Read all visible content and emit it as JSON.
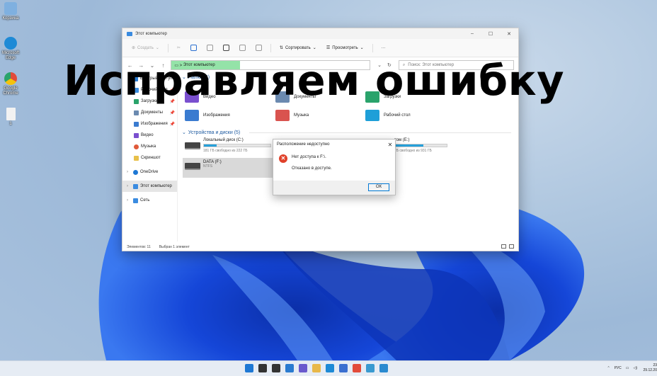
{
  "overlay_heading": "Исправляем ошибку",
  "desktop_icons": [
    {
      "label": "Корзина",
      "icon": "recycle-bin-icon",
      "color": "#7fb0e0"
    },
    {
      "label": "Microsoft Edge",
      "icon": "edge-icon",
      "color": "#1e8ad6"
    },
    {
      "label": "Google Chrome",
      "icon": "chrome-icon",
      "color": "#e24b3a"
    },
    {
      "label": "1",
      "icon": "text-file-icon",
      "color": "#f2f2f2"
    }
  ],
  "window": {
    "title": "Этот компьютер",
    "controls": {
      "minimize": "–",
      "maximize": "☐",
      "close": "✕"
    }
  },
  "toolbar": {
    "create": "Создать",
    "sort": "Сортировать",
    "view": "Просмотреть",
    "more": "···"
  },
  "address": {
    "path": "Этот компьютер",
    "search_placeholder": "Поиск: Этот компьютер"
  },
  "sidebar": {
    "items": [
      {
        "label": "Быстрый доступ",
        "icon": "star-icon",
        "color": "#2a7bd0",
        "pinned": false,
        "partial": true
      },
      {
        "label": "Рабочий стол",
        "icon": "desktop-icon",
        "color": "#3b8ee0",
        "pinned": true
      },
      {
        "label": "Загрузки",
        "icon": "downloads-icon",
        "color": "#2aa36b",
        "pinned": true
      },
      {
        "label": "Документы",
        "icon": "documents-icon",
        "color": "#6b8ab0",
        "pinned": true
      },
      {
        "label": "Изображения",
        "icon": "pictures-icon",
        "color": "#3a7bd0",
        "pinned": true
      },
      {
        "label": "Видео",
        "icon": "video-icon",
        "color": "#7a4fcf",
        "pinned": false
      },
      {
        "label": "Музыка",
        "icon": "music-icon",
        "color": "#e05a3a",
        "pinned": false
      },
      {
        "label": "Скриншот",
        "icon": "folder-icon",
        "color": "#e8c04a",
        "pinned": false
      },
      {
        "label": "OneDrive",
        "icon": "onedrive-icon",
        "color": "#1e78d4",
        "pinned": false
      },
      {
        "label": "Этот компьютер",
        "icon": "computer-icon",
        "color": "#3a8be0",
        "pinned": false,
        "selected": true
      },
      {
        "label": "Сеть",
        "icon": "network-icon",
        "color": "#3a8be0",
        "pinned": false
      }
    ]
  },
  "folders": [
    {
      "label": "Видео",
      "icon": "video-folder-icon",
      "color": "#7a4fcf"
    },
    {
      "label": "Документы",
      "icon": "documents-folder-icon",
      "color": "#6b8ab0"
    },
    {
      "label": "Загрузки",
      "icon": "downloads-folder-icon",
      "color": "#2aa36b"
    },
    {
      "label": "Изображения",
      "icon": "pictures-folder-icon",
      "color": "#3a7bd0"
    },
    {
      "label": "Музыка",
      "icon": "music-folder-icon",
      "color": "#d9534f"
    },
    {
      "label": "Рабочий стол",
      "icon": "desktop-folder-icon",
      "color": "#1e9fd8"
    }
  ],
  "folders_section_title": "Папки (6)",
  "drives_section_title": "Устройства и диски (5)",
  "drives": [
    {
      "name": "Локальный диск (C:)",
      "info": "181 ГБ свободно из 222 ГБ",
      "used": 0.19
    },
    {
      "name": "DATA (F:)",
      "info": "NTFS",
      "used": null,
      "selected": true
    },
    {
      "name": "том (E:)",
      "info": "ГБ свободно из 931 ГБ",
      "used": 0.55
    }
  ],
  "status": {
    "items": "Элементов: 11",
    "selected": "Выбран 1 элемент"
  },
  "dialog": {
    "title": "Расположение недоступно",
    "message": "Нет доступа к F:\\.",
    "detail": "Отказано в доступе.",
    "ok": "ОК",
    "close": "✕"
  },
  "taskbar": {
    "apps": [
      {
        "icon": "start-icon",
        "color": "#1e78d4"
      },
      {
        "icon": "search-icon",
        "color": "#333333"
      },
      {
        "icon": "task-view-icon",
        "color": "#333333"
      },
      {
        "icon": "widgets-icon",
        "color": "#2a7bd0"
      },
      {
        "icon": "teams-chat-icon",
        "color": "#6a5acd"
      },
      {
        "icon": "file-explorer-icon",
        "color": "#e8b84a"
      },
      {
        "icon": "edge-icon",
        "color": "#1e8ad6"
      },
      {
        "icon": "store-icon",
        "color": "#3a6fd0"
      },
      {
        "icon": "chrome-icon",
        "color": "#e24b3a"
      },
      {
        "icon": "photos-icon",
        "color": "#3a9ad0"
      },
      {
        "icon": "snipping-tool-icon",
        "color": "#2a8ad0"
      }
    ],
    "language": "РУС",
    "time": "23",
    "date": "29.12.20"
  }
}
